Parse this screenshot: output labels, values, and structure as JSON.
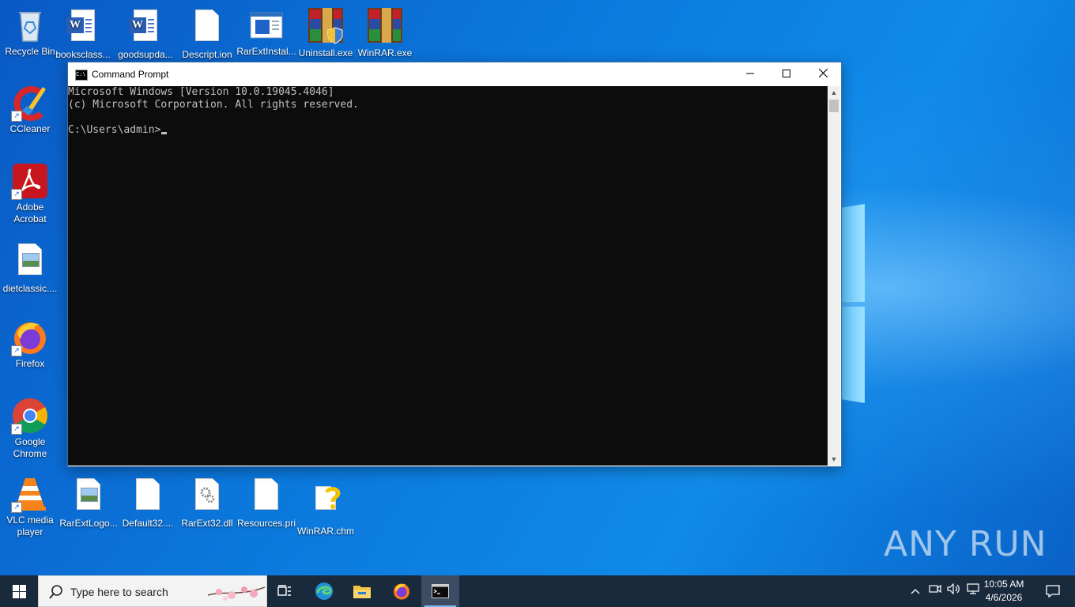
{
  "desktop": {
    "icons_top_row": [
      {
        "label": "Recycle Bin",
        "icon": "recycle-bin-icon"
      },
      {
        "label": "booksclass...",
        "icon": "word-document-icon"
      },
      {
        "label": "goodsupda...",
        "icon": "word-document-icon"
      },
      {
        "label": "Descript.ion",
        "icon": "blank-file-icon"
      },
      {
        "label": "RarExtInstal...",
        "icon": "installer-window-icon"
      },
      {
        "label": "Uninstall.exe",
        "icon": "winrar-shield-icon"
      },
      {
        "label": "WinRAR.exe",
        "icon": "winrar-icon"
      }
    ],
    "icons_left_column": [
      {
        "label": "CCleaner",
        "icon": "ccleaner-icon"
      },
      {
        "label": "Adobe Acrobat",
        "icon": "adobe-acrobat-icon"
      },
      {
        "label": "dietclassic....",
        "icon": "image-file-icon"
      },
      {
        "label": "Firefox",
        "icon": "firefox-icon"
      },
      {
        "label": "Google Chrome",
        "icon": "chrome-icon"
      },
      {
        "label": "VLC media player",
        "icon": "vlc-icon"
      }
    ],
    "icons_bottom_row": [
      {
        "label": "RarExtLogo...",
        "icon": "image-file-icon"
      },
      {
        "label": "Default32....",
        "icon": "blank-file-icon"
      },
      {
        "label": "RarExt32.dll",
        "icon": "dll-gear-icon"
      },
      {
        "label": "Resources.pri",
        "icon": "blank-file-icon"
      },
      {
        "label": "WinRAR.chm",
        "icon": "help-file-icon"
      }
    ],
    "watermark": "ANY RUN"
  },
  "cmd_window": {
    "title": "Command Prompt",
    "lines": [
      "Microsoft Windows [Version 10.0.19045.4046]",
      "(c) Microsoft Corporation. All rights reserved.",
      "",
      "C:\\Users\\admin>"
    ],
    "minimize": "—",
    "maximize": "☐",
    "close": "✕"
  },
  "taskbar": {
    "search_placeholder": "Type here to search",
    "pinned": [
      "task-view",
      "edge",
      "file-explorer",
      "firefox",
      "command-prompt"
    ],
    "active": "command-prompt",
    "time": "10:05 AM",
    "date": "4/6/2026"
  },
  "colors": {
    "console_bg": "#0c0c0c",
    "console_fg": "#c0c0c0",
    "taskbar_bg": "#1a2a3d"
  }
}
